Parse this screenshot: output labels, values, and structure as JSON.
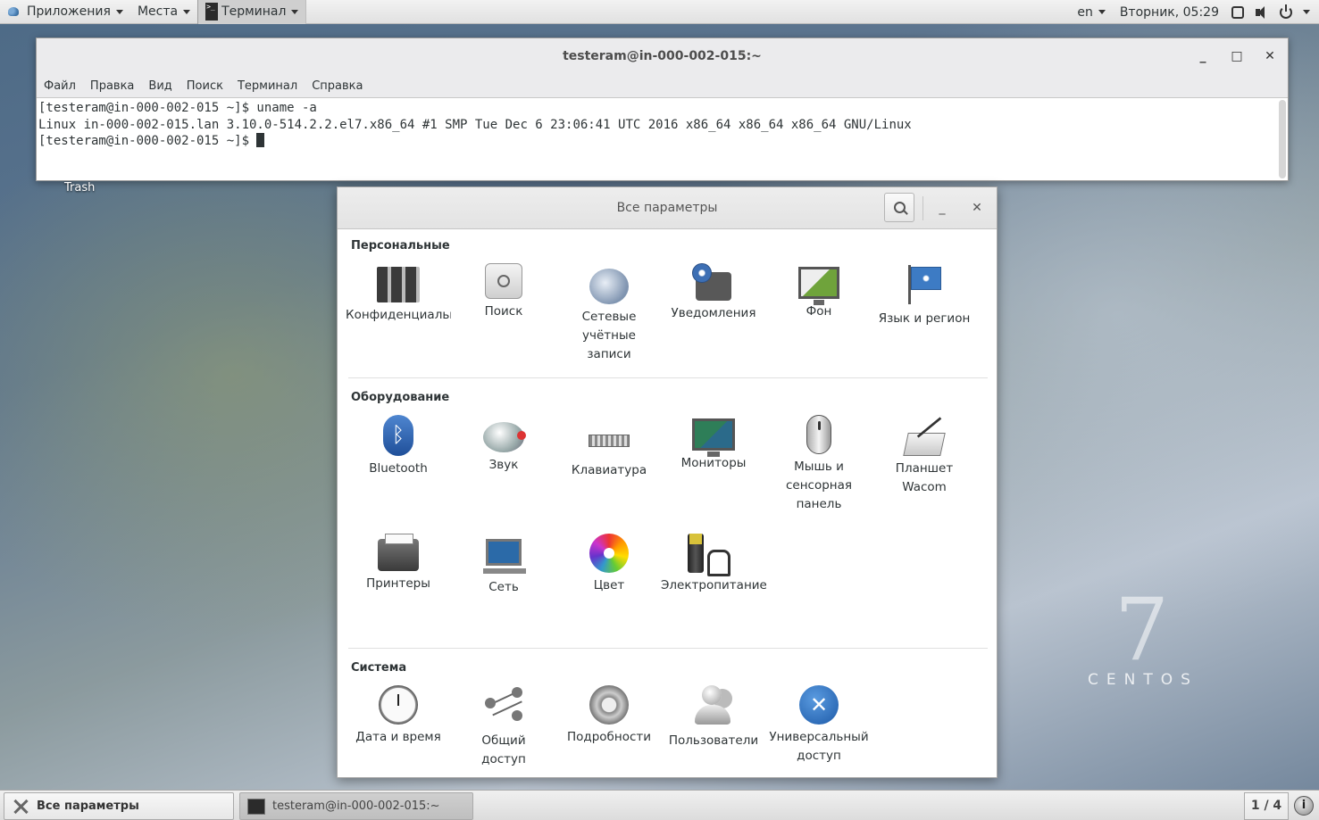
{
  "top_panel": {
    "applications": "Приложения",
    "places": "Места",
    "terminal_task": "Терминал",
    "keyboard_layout": "en",
    "clock": "Вторник, 05:29"
  },
  "terminal": {
    "title": "testeram@in-000-002-015:~",
    "menu": [
      "Файл",
      "Правка",
      "Вид",
      "Поиск",
      "Терминал",
      "Справка"
    ],
    "lines": [
      "[testeram@in-000-002-015 ~]$ uname -a",
      "Linux in-000-002-015.lan 3.10.0-514.2.2.el7.x86_64 #1 SMP Tue Dec 6 23:06:41 UTC 2016 x86_64 x86_64 x86_64 GNU/Linux",
      "[testeram@in-000-002-015 ~]$ "
    ],
    "buttons": {
      "minimize": "_",
      "maximize": "□",
      "close": "✕"
    }
  },
  "desktop": {
    "trash_label": "Trash",
    "centos_version": "7",
    "centos_word": "CENTOS"
  },
  "settings": {
    "title": "Все параметры",
    "buttons": {
      "minimize": "_",
      "close": "✕"
    },
    "sections": [
      {
        "title": "Персональные",
        "items": [
          {
            "label": "Конфиденциальность",
            "icon": "privacy-icon"
          },
          {
            "label": "Поиск",
            "icon": "search-icon"
          },
          {
            "label": "Сетевые учётные записи",
            "icon": "online-accounts-icon"
          },
          {
            "label": "Уведомления",
            "icon": "notifications-icon"
          },
          {
            "label": "Фон",
            "icon": "background-icon"
          },
          {
            "label": "Язык и регион",
            "icon": "region-flag-icon"
          }
        ]
      },
      {
        "title": "Оборудование",
        "items": [
          {
            "label": "Bluetooth",
            "icon": "bluetooth-icon"
          },
          {
            "label": "Звук",
            "icon": "sound-icon"
          },
          {
            "label": "Клавиатура",
            "icon": "keyboard-icon"
          },
          {
            "label": "Мониторы",
            "icon": "monitor-icon"
          },
          {
            "label": "Мышь и сенсорная панель",
            "icon": "mouse-icon"
          },
          {
            "label": "Планшет Wacom",
            "icon": "wacom-tablet-icon"
          },
          {
            "label": "Принтеры",
            "icon": "printer-icon"
          },
          {
            "label": "Сеть",
            "icon": "network-icon"
          },
          {
            "label": "Цвет",
            "icon": "color-icon"
          },
          {
            "label": "Электропитание",
            "icon": "power-icon"
          }
        ]
      },
      {
        "title": "Система",
        "items": [
          {
            "label": "Дата и время",
            "icon": "clock-icon"
          },
          {
            "label": "Общий доступ",
            "icon": "sharing-icon"
          },
          {
            "label": "Подробности",
            "icon": "details-gear-icon"
          },
          {
            "label": "Пользователи",
            "icon": "users-icon"
          },
          {
            "label": "Универсальный доступ",
            "icon": "accessibility-icon"
          }
        ]
      }
    ]
  },
  "bottom_panel": {
    "settings_task": "Все параметры",
    "terminal_task": "testeram@in-000-002-015:~",
    "workspace": "1 / 4",
    "info": "i"
  }
}
